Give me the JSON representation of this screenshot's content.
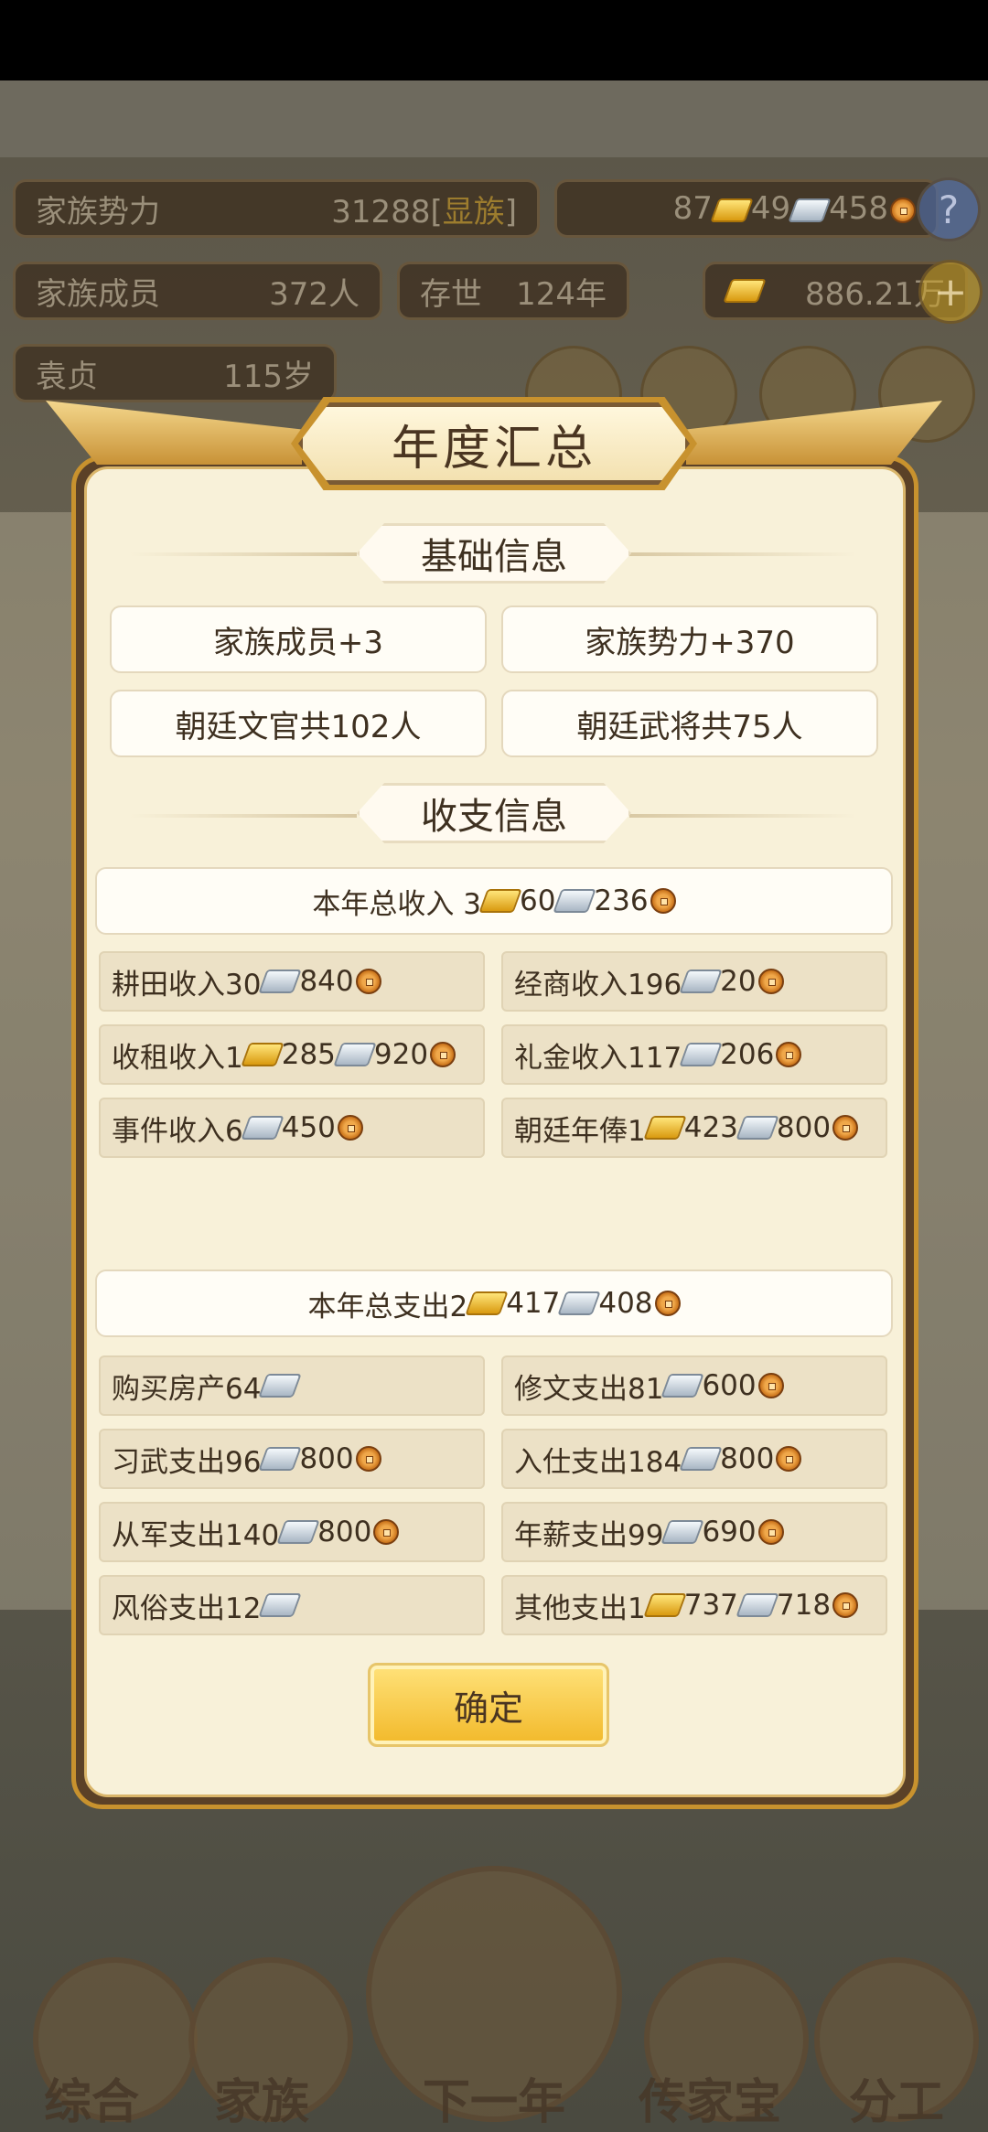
{
  "background": {
    "hud": {
      "power_label": "家族势力",
      "power_value": "31288",
      "power_rank_open": "[",
      "power_rank": "显族",
      "power_rank_close": "]",
      "gold": "87",
      "silver": "49",
      "copper": "458",
      "help": "?",
      "members_label": "家族成员",
      "members_value": "372人",
      "age_label": "存世",
      "age_value": "124年",
      "money": "886.21万",
      "add": "+",
      "patriarch_name": "袁贞",
      "patriarch_age": "115岁"
    },
    "nav": [
      "综合",
      "家族",
      "下一年",
      "传家宝",
      "分工"
    ]
  },
  "dialog": {
    "title": "年度汇总",
    "basic_section": "基础信息",
    "basic": [
      "家族成员+3",
      "家族势力+370",
      "朝廷文官共102人",
      "朝廷武将共75人"
    ],
    "finance_section": "收支信息",
    "income_total": {
      "label": "本年总收入 3",
      "gold_amount": "60",
      "silver_amount": "236"
    },
    "income_items": [
      {
        "label": "耕田收入30",
        "silver": "840"
      },
      {
        "label": "经商收入196",
        "silver": "20"
      },
      {
        "label": "收租收入1",
        "gold": "285",
        "silver": "920"
      },
      {
        "label": "礼金收入117",
        "silver": "206"
      },
      {
        "label": "事件收入6",
        "silver": "450"
      },
      {
        "label": "朝廷年俸1",
        "gold": "423",
        "silver": "800"
      }
    ],
    "expense_total": {
      "label": "本年总支出2",
      "gold_amount": "417",
      "silver_amount": "408"
    },
    "expense_items": [
      {
        "label": "购买房产64"
      },
      {
        "label": "修文支出81",
        "silver": "600"
      },
      {
        "label": "习武支出96",
        "silver": "800"
      },
      {
        "label": "入仕支出184",
        "silver": "800"
      },
      {
        "label": "从军支出140",
        "silver": "800"
      },
      {
        "label": "年薪支出99",
        "silver": "690"
      },
      {
        "label": "风俗支出12"
      },
      {
        "label": "其他支出1",
        "gold": "737",
        "silver": "718"
      }
    ],
    "confirm": "确定"
  },
  "colors": {
    "dialog_bg": "#f8f1d9",
    "frame": "#5b4127",
    "gold_trim": "#c8922e",
    "confirm": "#f2b92a",
    "text": "#3e3020"
  }
}
